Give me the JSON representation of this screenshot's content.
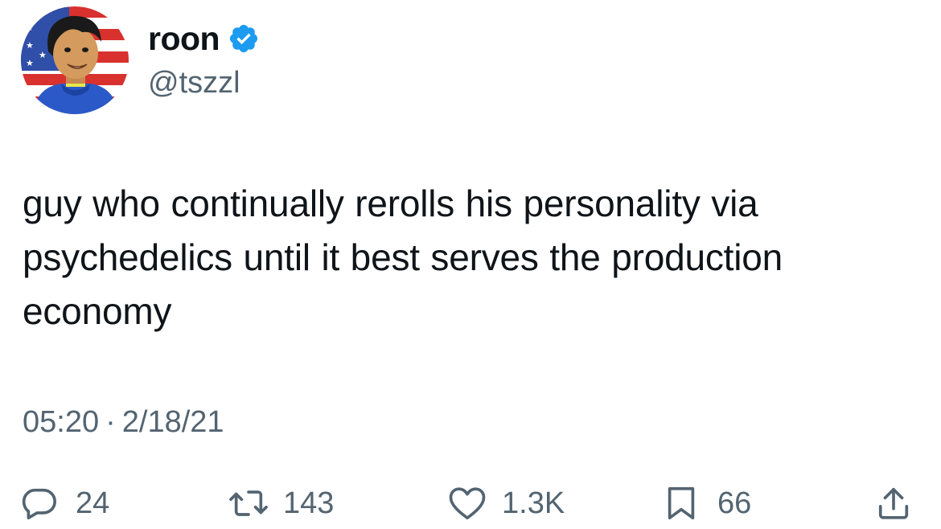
{
  "author": {
    "display_name": "roon",
    "handle": "@tszzl",
    "verified": true,
    "verified_color": "#1d9bf0"
  },
  "tweet": {
    "text": "guy who continually rerolls his personality via psychedelics until it best serves the production economy",
    "time": "05:20",
    "separator": "·",
    "date": "2/18/21"
  },
  "actions": {
    "reply": {
      "icon": "reply-icon",
      "count": "24"
    },
    "retweet": {
      "icon": "retweet-icon",
      "count": "143"
    },
    "like": {
      "icon": "heart-icon",
      "count": "1.3K"
    },
    "bookmark": {
      "icon": "bookmark-icon",
      "count": "66"
    },
    "share": {
      "icon": "share-icon"
    }
  },
  "colors": {
    "text": "#0f1419",
    "secondary": "#536471",
    "background": "#ffffff"
  }
}
